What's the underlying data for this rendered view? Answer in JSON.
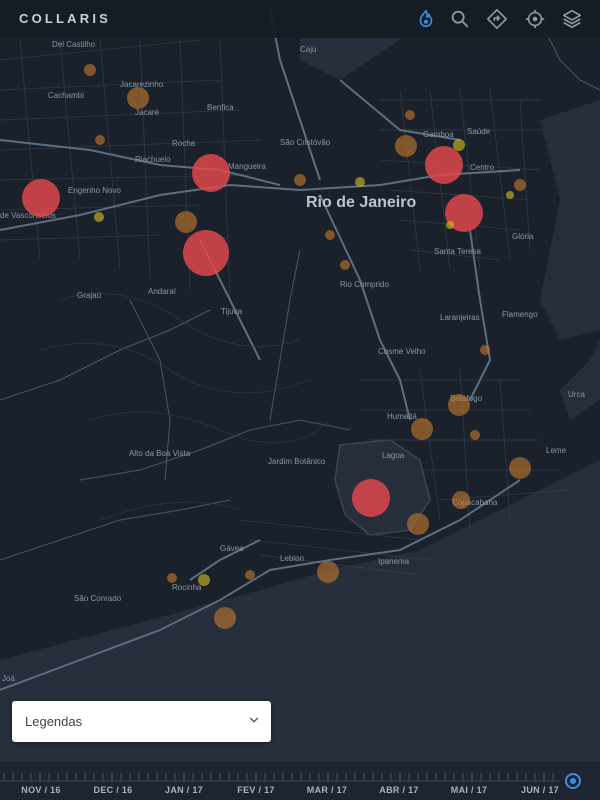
{
  "app": {
    "title": "COLLARIS"
  },
  "toolbar": {
    "icons": [
      "heat-icon",
      "search-icon",
      "directions-icon",
      "locate-icon",
      "layers-icon"
    ],
    "active_color": "#3d8fe0",
    "icon_color": "#8f99a5"
  },
  "map": {
    "city_label": "Rio de Janeiro",
    "place_labels": [
      "Del Castilho",
      "Caju",
      "Jacarezinho",
      "Cachambi",
      "Jacaré",
      "Benfica",
      "Gamboa",
      "Saúde",
      "Rocha",
      "São Cristóvão",
      "Riachuelo",
      "Mangueira",
      "Centro",
      "Engenho Novo",
      "de Vasconcelos",
      "Santa Teresa",
      "Glória",
      "Grajaú",
      "Andaraí",
      "Rio Comprido",
      "Tijuca",
      "Laranjeiras",
      "Flamengo",
      "Cosme Velho",
      "Urca",
      "Botafogo",
      "Humaitá",
      "Leme",
      "Alto da Boa Vista",
      "Jardim Botânico",
      "Lagoa",
      "Copacabana",
      "Gávea",
      "Leblon",
      "Ipanema",
      "Rocinha",
      "São Conrado",
      "Joá"
    ],
    "colors": {
      "hotspot_high": "#e5484d",
      "hotspot_mid": "#c7792a",
      "hotspot_low": "#d9c21e"
    }
  },
  "legend": {
    "label": "Legendas",
    "expanded": false
  },
  "timeline": {
    "months": [
      "NOV / 16",
      "DEC / 16",
      "JAN / 17",
      "FEV / 17",
      "MAR / 17",
      "ABR / 17",
      "MAI / 17",
      "JUN / 17"
    ],
    "selected": "JUN / 17"
  }
}
